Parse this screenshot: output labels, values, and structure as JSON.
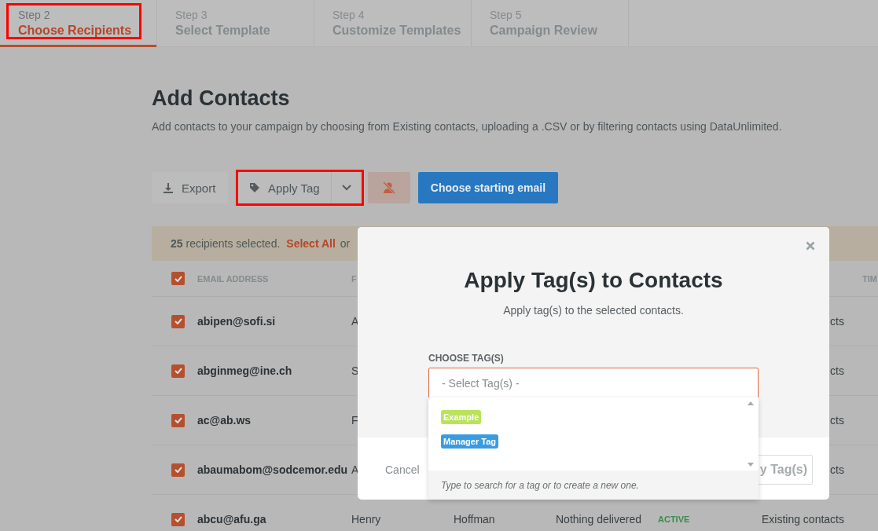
{
  "tabs": [
    {
      "step": "Step 2",
      "title": "Choose Recipients",
      "selected": true,
      "highlighted": true
    },
    {
      "step": "Step 3",
      "title": "Select Template",
      "selected": false,
      "highlighted": false
    },
    {
      "step": "Step 4",
      "title": "Customize Templates",
      "selected": false,
      "highlighted": false
    },
    {
      "step": "Step 5",
      "title": "Campaign Review",
      "selected": false,
      "highlighted": false
    }
  ],
  "heading": "Add Contacts",
  "description": "Add contacts to your campaign by choosing from Existing contacts, uploading a .CSV or by filtering contacts using DataUnlimited.",
  "toolbar": {
    "export": "Export",
    "apply_tag": {
      "label": "Apply Tag",
      "highlighted": true
    },
    "remove_disabled": true,
    "primary": "Choose starting email"
  },
  "notice": {
    "text": "**25** recipients selected.",
    "link": "Select All",
    "joiner": "or"
  },
  "table": {
    "all_checked": true,
    "columns": {
      "email": "EMAIL ADDRESS",
      "first_name": "F",
      "time": "TIM"
    },
    "rows": [
      {
        "checked": true,
        "email": "abipen@sofi.si",
        "first_name": "A",
        "source": "cts"
      },
      {
        "checked": true,
        "email": "abginmeg@ine.ch",
        "first_name": "S",
        "source": "cts"
      },
      {
        "checked": true,
        "email": "ac@ab.ws",
        "first_name": "F",
        "source": "cts"
      },
      {
        "checked": true,
        "email": "abaumabom@sodcemor.edu",
        "first_name": "A",
        "source": "cts"
      },
      {
        "checked": true,
        "email": "abcu@afu.ga",
        "first_name": "Henry",
        "last_name": "Hoffman",
        "delivery": "Nothing delivered",
        "status": "ACTIVE",
        "source": "Existing contacts"
      }
    ]
  },
  "modal": {
    "title": "Apply Tag(s) to Contacts",
    "subtitle": "Apply tag(s) to the selected contacts.",
    "field_label": "CHOOSE TAG(S)",
    "placeholder": "- Select Tag(s) -",
    "options": [
      {
        "label": "Example",
        "color": "#b9e35a"
      },
      {
        "label": "Manager Tag",
        "color": "#3a9be0"
      }
    ],
    "hint": "Type to search for a tag or to create a new one.",
    "cancel": "Cancel",
    "submit": "y Tag(s)"
  }
}
